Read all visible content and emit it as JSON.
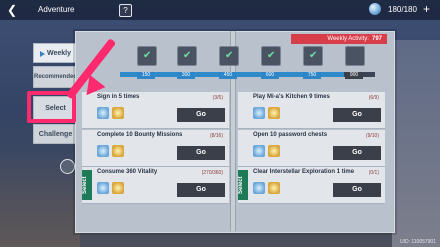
{
  "header": {
    "title": "Adventure",
    "help": "?",
    "currency": "180/180",
    "plus": "+"
  },
  "tabs": [
    {
      "label": "Weekly"
    },
    {
      "label": "Recommended"
    },
    {
      "label": "Select"
    },
    {
      "label": "Challenge"
    }
  ],
  "weekly_activity": {
    "label": "Weekly Activity:",
    "value": "797"
  },
  "milestones": [
    "150",
    "300",
    "450",
    "600",
    "750",
    "900"
  ],
  "progress_fraction": 0.88,
  "row_labels": {
    "left_section": "Select",
    "right_section": "Select"
  },
  "tasks_left": [
    {
      "title": "Sign in 5 times",
      "count": "(3/5)",
      "go": "Go"
    },
    {
      "title": "Complete 10 Bounty Missions",
      "count": "(8/16)",
      "go": "Go"
    },
    {
      "title": "Consume 360 Vitality",
      "count": "(270/360)",
      "go": "Go"
    }
  ],
  "tasks_right": [
    {
      "title": "Play Mi-a's Kitchen 9 times",
      "count": "(6/9)",
      "go": "Go"
    },
    {
      "title": "Open 10 password chests",
      "count": "(9/10)",
      "go": "Go"
    },
    {
      "title": "Clear Interstellar Exploration 1 time",
      "count": "(0/1)",
      "go": "Go"
    }
  ],
  "uid": "UID: 110057901"
}
